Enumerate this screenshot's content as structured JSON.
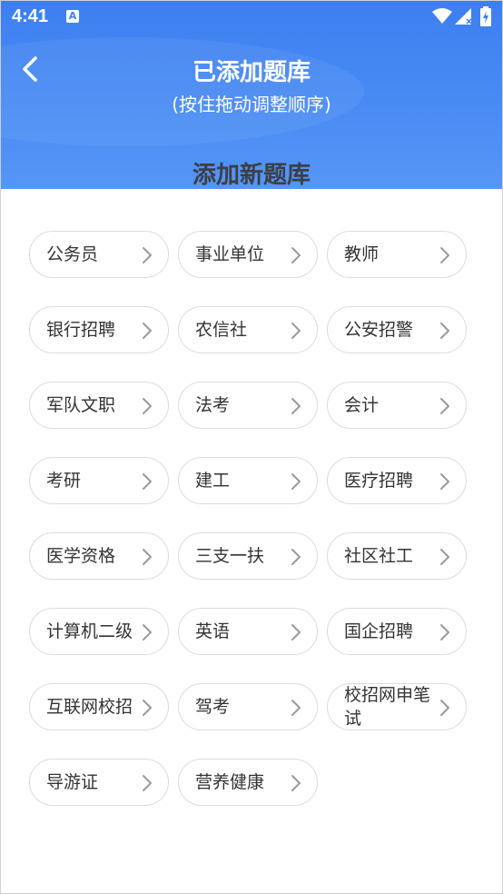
{
  "status_bar": {
    "time": "4:41",
    "notification_icon": "A"
  },
  "header": {
    "title": "已添加题库",
    "subtitle": "(按住拖动调整顺序)",
    "back_icon": "chevron-left-icon"
  },
  "section": {
    "title": "添加新题库"
  },
  "colors": {
    "header_blue": "#3d7ff0",
    "chip_border": "#dcdcdc",
    "chip_text": "#333333",
    "arrow_gray": "#9a9a9a"
  },
  "categories": [
    {
      "label": "公务员"
    },
    {
      "label": "事业单位"
    },
    {
      "label": "教师"
    },
    {
      "label": "银行招聘"
    },
    {
      "label": "农信社"
    },
    {
      "label": "公安招警"
    },
    {
      "label": "军队文职"
    },
    {
      "label": "法考"
    },
    {
      "label": "会计"
    },
    {
      "label": "考研"
    },
    {
      "label": "建工"
    },
    {
      "label": "医疗招聘"
    },
    {
      "label": "医学资格"
    },
    {
      "label": "三支一扶"
    },
    {
      "label": "社区社工"
    },
    {
      "label": "计算机二级"
    },
    {
      "label": "英语"
    },
    {
      "label": "国企招聘"
    },
    {
      "label": "互联网校招"
    },
    {
      "label": "驾考"
    },
    {
      "label": "校招网申笔试"
    },
    {
      "label": "导游证"
    },
    {
      "label": "营养健康"
    }
  ]
}
